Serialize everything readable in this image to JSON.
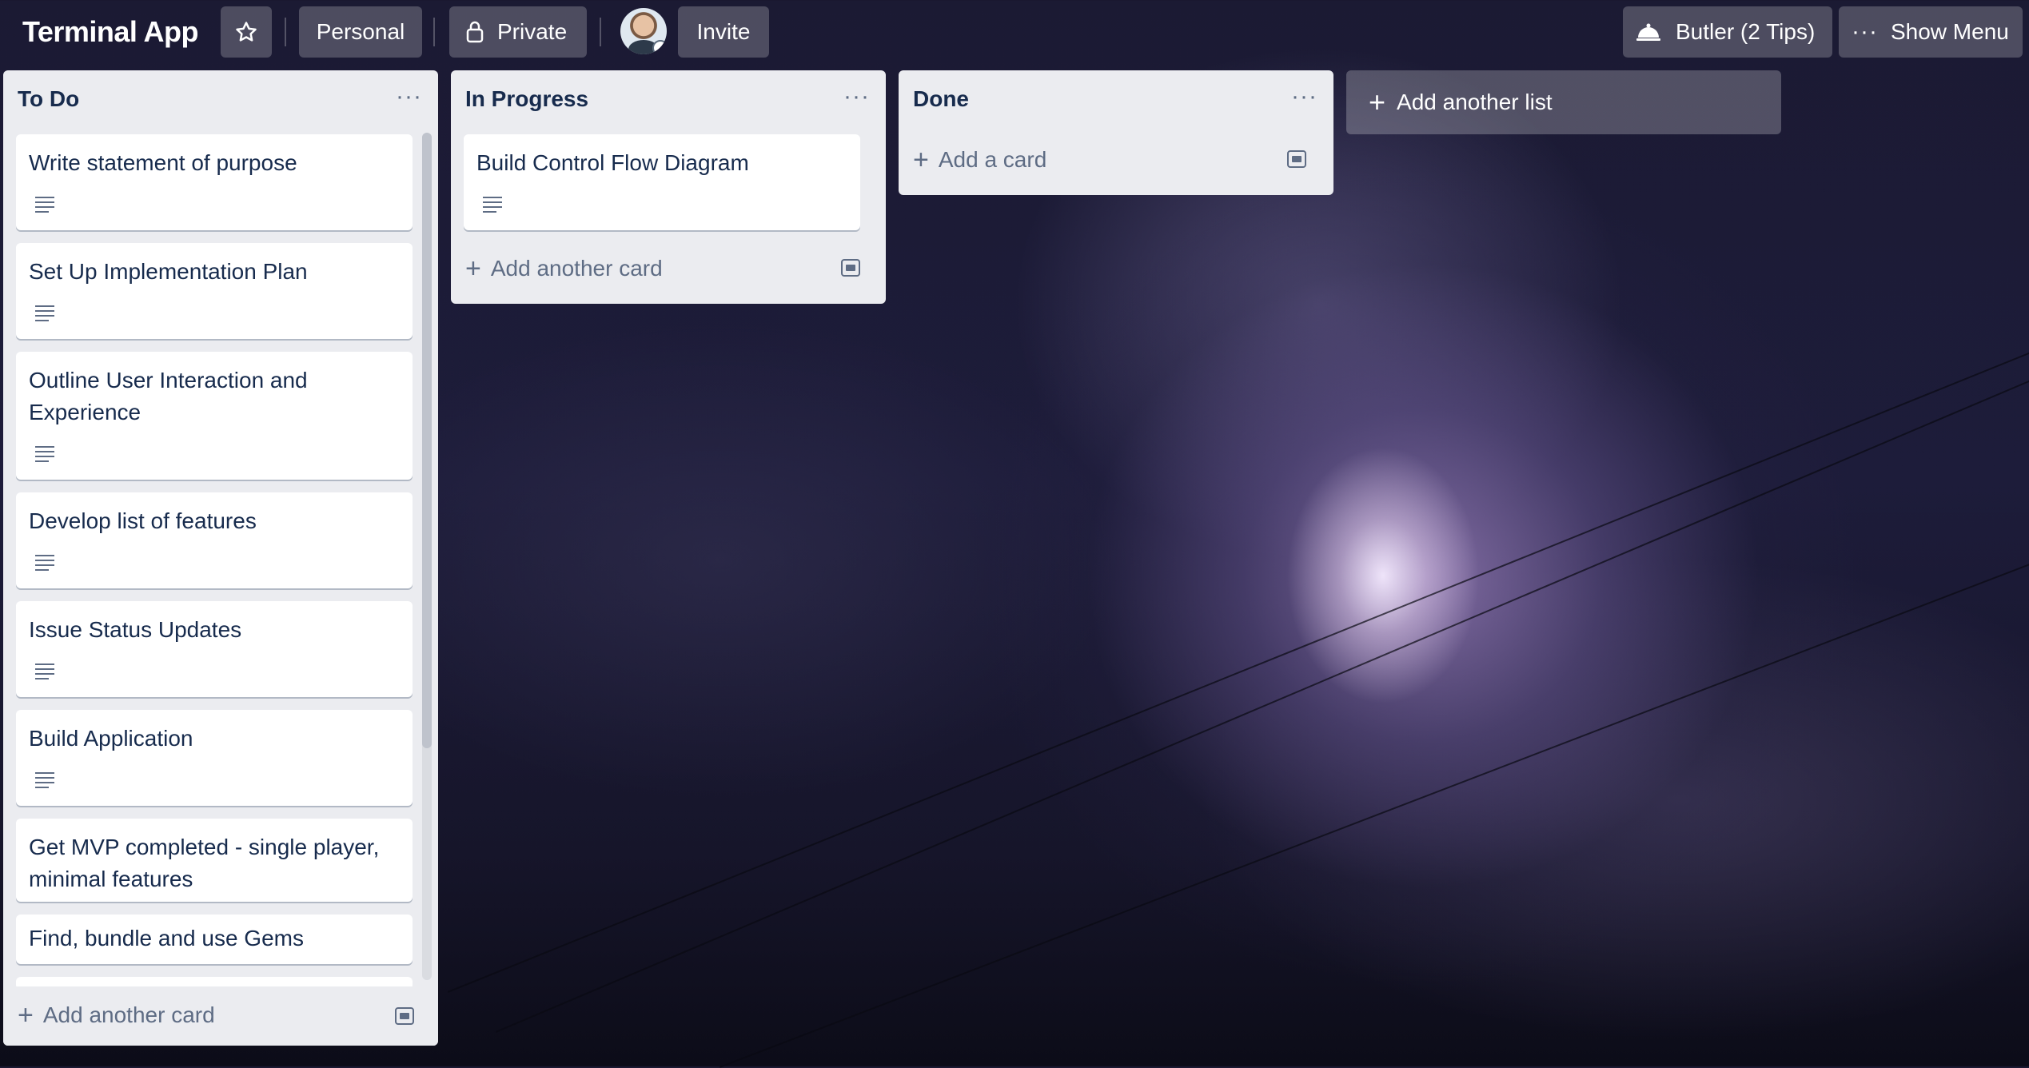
{
  "header": {
    "board_title": "Terminal App",
    "visibility_team": "Personal",
    "privacy": "Private",
    "invite": "Invite",
    "butler": "Butler (2 Tips)",
    "show_menu": "Show Menu"
  },
  "lists": [
    {
      "title": "To Do",
      "cards": [
        {
          "title": "Write statement of purpose"
        },
        {
          "title": "Set Up Implementation Plan"
        },
        {
          "title": "Outline User Interaction and Experience"
        },
        {
          "title": "Develop list of features"
        },
        {
          "title": "Issue Status Updates"
        },
        {
          "title": "Build Application"
        },
        {
          "title": "Get MVP completed - single player, minimal features"
        },
        {
          "title": "Find, bundle and use Gems"
        }
      ],
      "add_label": "Add another card"
    },
    {
      "title": "In Progress",
      "cards": [
        {
          "title": "Build Control Flow Diagram"
        }
      ],
      "add_label": "Add another card"
    },
    {
      "title": "Done",
      "cards": [],
      "add_label": "Add a card"
    }
  ],
  "add_list_label": "Add another list",
  "icons": {
    "star": "star-icon",
    "lock": "lock-icon",
    "butler": "butler-bell-icon",
    "menu": "ellipsis-icon",
    "description": "description-icon",
    "template": "card-template-icon",
    "plus": "plus-icon"
  },
  "colors": {
    "list_bg": "#ebecf0",
    "card_bg": "#ffffff",
    "text": "#172b4d",
    "muted": "#5e6c84",
    "header_button_bg": "rgba(255,255,255,0.22)"
  }
}
